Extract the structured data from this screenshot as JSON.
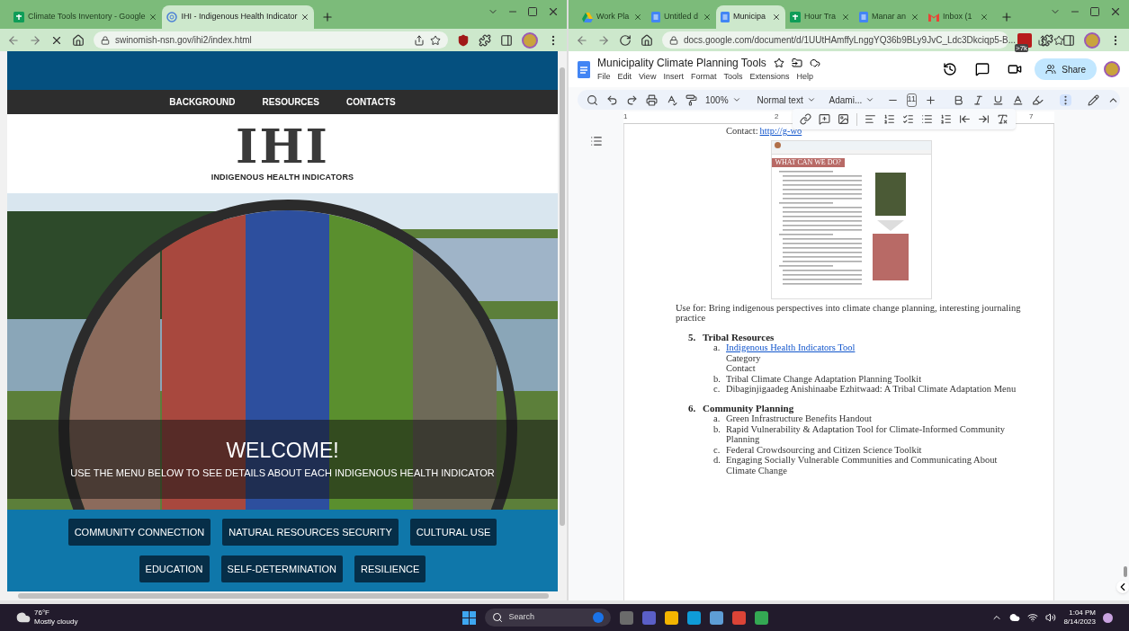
{
  "left_window": {
    "tabs": [
      {
        "title": "Climate Tools Inventory - Google",
        "kind": "sheets",
        "selected": false
      },
      {
        "title": "IHI - Indigenous Health Indicator",
        "kind": "site",
        "selected": true
      }
    ],
    "loading": true,
    "address": "swinomish-nsn.gov/ihi2/index.html",
    "page": {
      "nav": [
        "BACKGROUND",
        "RESOURCES",
        "CONTACTS"
      ],
      "logo_text": "IHI",
      "logo_caption": "INDIGENOUS HEALTH INDICATORS",
      "welcome_title": "WELCOME!",
      "welcome_text": "USE THE MENU BELOW TO SEE DETAILS ABOUT EACH INDIGENOUS HEALTH INDICATOR",
      "indicator_rows": [
        [
          "COMMUNITY CONNECTION",
          "NATURAL RESOURCES SECURITY",
          "CULTURAL USE"
        ],
        [
          "EDUCATION",
          "SELF-DETERMINATION",
          "RESILIENCE"
        ]
      ]
    }
  },
  "right_window": {
    "tabs": [
      {
        "title": "Work Pla",
        "kind": "drive",
        "selected": false
      },
      {
        "title": "Untitled d",
        "kind": "docs",
        "selected": false
      },
      {
        "title": "Municipa",
        "kind": "docs",
        "selected": true
      },
      {
        "title": "Hour Tra",
        "kind": "sheets",
        "selected": false
      },
      {
        "title": "Manar an",
        "kind": "docs",
        "selected": false
      },
      {
        "title": "Inbox (1",
        "kind": "gmail",
        "selected": false
      }
    ],
    "loading": false,
    "address": "docs.google.com/document/d/1UUtHAmffyLnggYQ36b9BLy9JvC_Ldc3Dkciqp5-B...",
    "extension_badge": ">7k",
    "doc": {
      "title": "Municipality Climate Planning Tools",
      "menu": [
        "File",
        "Edit",
        "View",
        "Insert",
        "Format",
        "Tools",
        "Extensions",
        "Help"
      ],
      "share": "Share",
      "toolbar": {
        "zoom": "100%",
        "style": "Normal text",
        "font": "Adami...",
        "font_size": "11"
      },
      "ruler": [
        "1",
        "2",
        "7"
      ],
      "contact_label": "Contact:",
      "contact_link": "http://g-wo",
      "image_heading": "WHAT CAN WE DO?",
      "use_for": "Use for: Bring indigenous perspectives into climate change planning,  interesting journaling practice",
      "sections": [
        {
          "number": "5.",
          "title": "Tribal Resources",
          "items": [
            {
              "marker": "a.",
              "text": "Indigenous Health Indicators Tool",
              "kind": "link",
              "notes": [
                "Category",
                "Contact"
              ]
            },
            {
              "marker": "b.",
              "text": "Tribal Climate Change Adaptation Planning Toolkit",
              "kind": "text"
            },
            {
              "marker": "c.",
              "text": "Dibaginjigaadeg Anishinaabe Ezhitwaad: A Tribal Climate Adaptation Menu",
              "kind": "text"
            }
          ]
        },
        {
          "number": "6.",
          "title": "Community Planning",
          "items": [
            {
              "marker": "a.",
              "text": "Green Infrastructure Benefits Handout",
              "kind": "text"
            },
            {
              "marker": "b.",
              "text": "Rapid Vulnerability & Adaptation Tool for Climate-Informed Community Planning",
              "kind": "text"
            },
            {
              "marker": "c.",
              "text": "Federal Crowdsourcing and Citizen Science Toolkit",
              "kind": "text"
            },
            {
              "marker": "d.",
              "text": "Engaging Socially Vulnerable Communities and Communicating About Climate Change",
              "kind": "text"
            }
          ]
        }
      ]
    }
  },
  "taskbar": {
    "temperature": "76°F",
    "weather": "Mostly cloudy",
    "search": "Search",
    "time": "1:04 PM",
    "date": "8/14/2023"
  }
}
